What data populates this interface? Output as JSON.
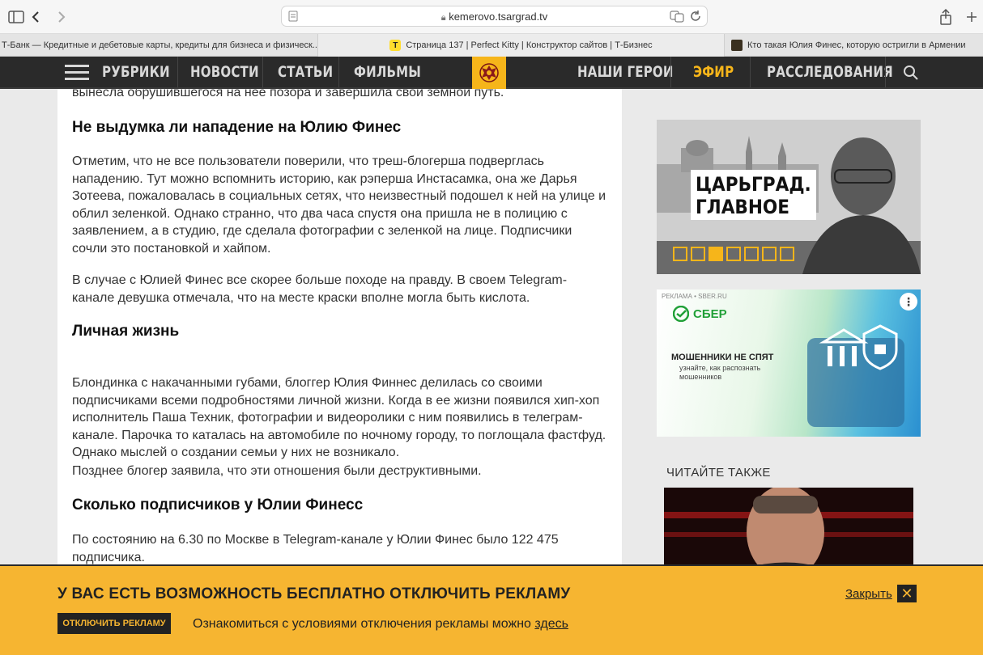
{
  "browser": {
    "url": "kemerovo.tsargrad.tv",
    "tabs": [
      {
        "label": "Т-Банк — Кредитные и дебетовые карты, кредиты для бизнеса и физическ..."
      },
      {
        "label": "Страница 137 | Perfect Kitty | Конструктор сайтов | Т-Бизнес"
      },
      {
        "label": "Кто такая Юлия Финес, которую остригли в Армении"
      }
    ]
  },
  "nav": {
    "items": [
      "РУБРИКИ",
      "НОВОСТИ",
      "СТАТЬИ",
      "ФИЛЬМЫ",
      "НАШИ ГЕРОИ",
      "ЭФИР",
      "РАССЛЕДОВАНИЯ"
    ],
    "accent": "#f6b51a"
  },
  "article": {
    "top_fragment": "вынесла обрушившегося на нее позора и завершила свой земной путь.",
    "h_fake": "Не выдумка ли нападение на Юлию Финес",
    "p1": "Отметим, что не все пользователи поверили, что треш-блогерша подверглась нападению. Тут можно вспомнить историю, как рэперша Инстасамка, она же Дарья Зотеева, пожаловалась в социальных сетях, что неизвестный подошел к ней на улице и облил зеленкой. Однако странно, что два часа спустя она пришла не в полицию с заявлением, а в студию, где сделала фотографии с зеленкой на лице. Подписчики сочли это постановкой и хайпом.",
    "p2": "В случае с Юлией Финес все скорее больше походе на правду. В своем Telegram-канале девушка отмечала, что на месте краски вполне могла быть кислота.",
    "h_life": "Личная жизнь",
    "p3a": "Блондинка с накачанными губами, блоггер Юлия Финнес делилась со своими подписчиками всеми подробностями личной жизни. Когда в ее жизни появился хип-хоп исполнитель Паша Техник, фотографии и видеоролики с ним появились в телеграм-канале. Парочка то каталась на автомобиле по ночному городу, то поглощала фастфуд. Однако мыслей о создании семьи у них не возникало.",
    "p3b": "Позднее блогер заявила, что эти отношения были деструктивными.",
    "h_subs": "Сколько подписчиков у Юлии Финесс",
    "p4": "По состоянию на 6.30 по Москве  в Telegram-канале у Юлии Финес   было 122 475 подписчика."
  },
  "sidebar": {
    "banner1_title_1": "ЦАРЬГРАД.",
    "banner1_title_2": "ГЛАВНОЕ",
    "banner2_ad_label": "РЕКЛАМА • SBER.RU",
    "banner2_brand": "СБЕР",
    "banner2_headline": "МОШЕННИКИ НЕ СПЯТ",
    "banner2_sub": "узнайте, как распознать мошенников",
    "also_label": "ЧИТАЙТЕ ТАКЖЕ"
  },
  "adbar": {
    "title": "У ВАС ЕСТЬ ВОЗМОЖНОСТЬ БЕСПЛАТНО ОТКЛЮЧИТЬ РЕКЛАМУ",
    "button": "ОТКЛЮЧИТЬ РЕКЛАМУ",
    "text": "Ознакомиться с условиями отключения рекламы можно ",
    "link": "здесь",
    "close": "Закрыть",
    "color": "#f6b531"
  }
}
